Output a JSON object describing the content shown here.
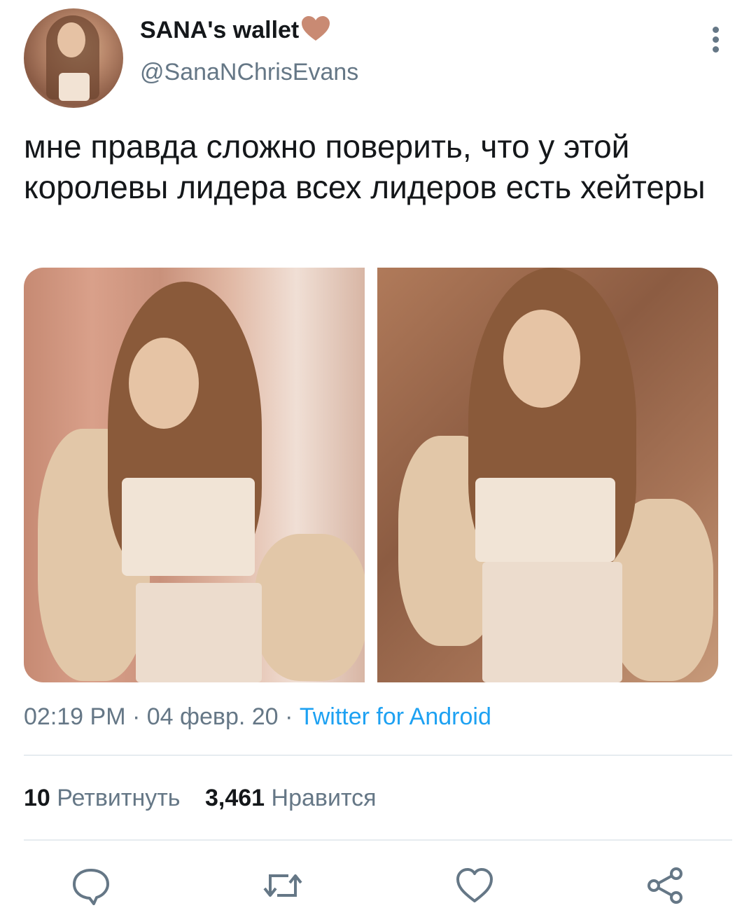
{
  "tweet": {
    "display_name": "SANA's wallet",
    "handle": "@SanaNChrisEvans",
    "text": "мне правда сложно поверить, что у этой королевы лидера всех лидеров есть хейтеры",
    "time": "02:19 PM",
    "separator": "·",
    "date": "04 февр. 20",
    "source": "Twitter for Android"
  },
  "stats": {
    "retweets_count": "10",
    "retweets_label": "Ретвитнуть",
    "likes_count": "3,461",
    "likes_label": "Нравится"
  },
  "icons": {
    "name_emoji": "brown-heart-icon",
    "more": "more-vertical-icon",
    "reply": "reply-icon",
    "retweet": "retweet-icon",
    "like": "like-icon",
    "share": "share-icon"
  },
  "colors": {
    "accent": "#1da1f2",
    "secondary_text": "#657786",
    "heart": "#c98a73"
  }
}
